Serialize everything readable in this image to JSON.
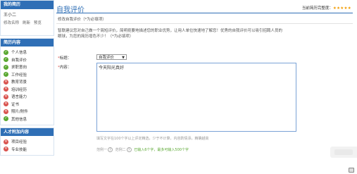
{
  "sidebar": {
    "profile_header": "我的简历",
    "name": "王小二",
    "links": [
      "修改名称",
      "刷新",
      "预览"
    ],
    "nav_header": "简历内容",
    "nav_items": [
      {
        "label": "个人信息",
        "status": "ok"
      },
      {
        "label": "自我评价",
        "status": "ok"
      },
      {
        "label": "求职意向",
        "status": "ok"
      },
      {
        "label": "工作经验",
        "status": "ok"
      },
      {
        "label": "教育背景",
        "status": "no"
      },
      {
        "label": "培训经历",
        "status": "no"
      },
      {
        "label": "语言能力",
        "status": "no"
      },
      {
        "label": "证书",
        "status": "no"
      },
      {
        "label": "照片/附件",
        "status": "no"
      },
      {
        "label": "其他信息",
        "status": "ok"
      }
    ],
    "talent_header": "人才附加内容",
    "talent_items": [
      {
        "label": "项目经验",
        "status": "no"
      },
      {
        "label": "专业技能",
        "status": "no"
      }
    ]
  },
  "main": {
    "title": "自我评价",
    "completeness_label": "当前简历完整度：",
    "stars": "★★★★★",
    "note": "修改自我评价（*为必填项）",
    "description": "智联建议您对自己做一个简短评价，简明扼要地描述您的职业优势，让用人单位快速地了解您！优秀的自我评价可以吸引招聘人员的眼球，为您的简历增色不少！（*为必填项）",
    "title_field_label": "标题：",
    "title_field_value": "自我评价",
    "content_field_label": "内容：",
    "content_value": "今天阳光真好",
    "hint": "填写文字在100个字以上评定精选，少于不计算，内容酌情添，精确越高",
    "example1": "范例一",
    "example2": "范例二",
    "status_text": "已输入6个字，最多可输入500个字"
  },
  "colors": {
    "brand": "#2f6fb6",
    "ok": "#5aa832",
    "no": "#d9534f",
    "star": "#f29b00"
  }
}
